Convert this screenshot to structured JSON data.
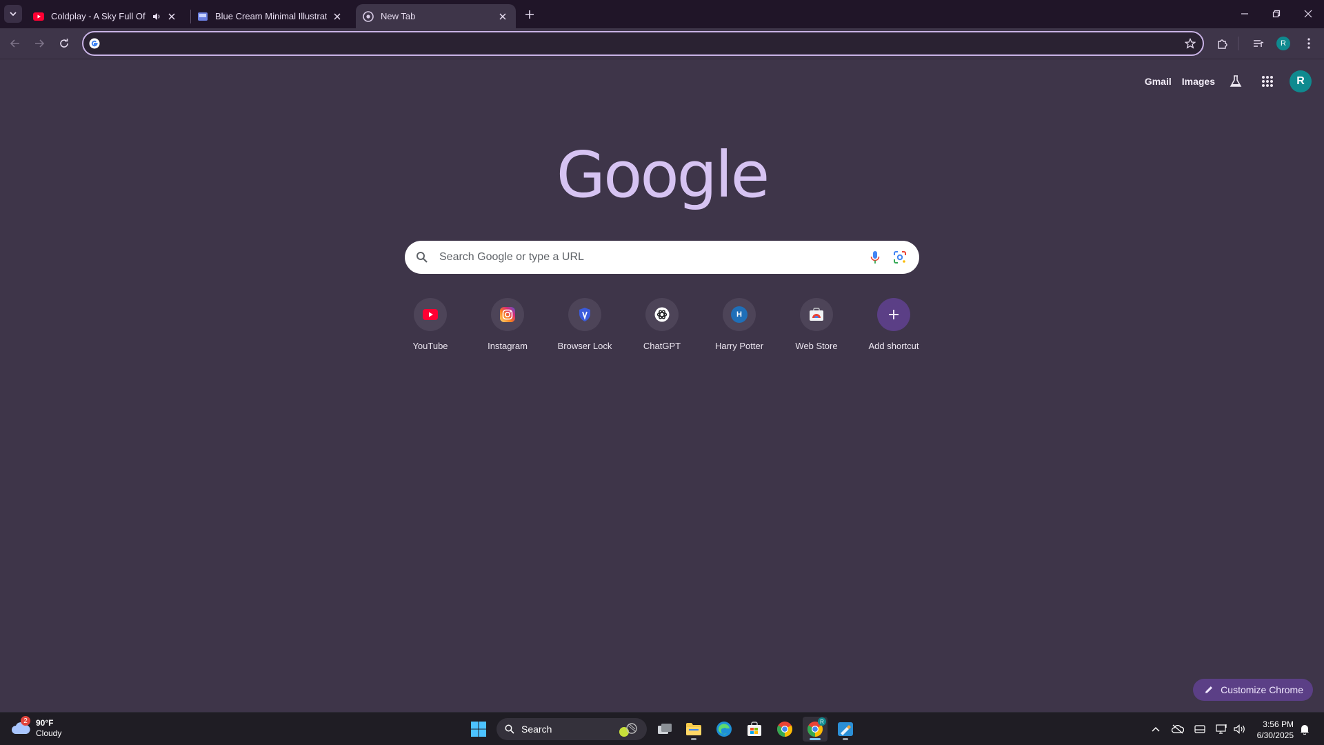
{
  "tabs": [
    {
      "title": "Coldplay - A Sky Full Of Stars",
      "favicon": "youtube-icon",
      "audio": true
    },
    {
      "title": "Blue Cream Minimal Illustrated",
      "favicon": "canva-icon",
      "audio": false
    },
    {
      "title": "New Tab",
      "favicon": "chrome-icon",
      "audio": false
    }
  ],
  "toolbar": {
    "omnibox_value": "",
    "profile_initial": "R"
  },
  "header": {
    "gmail": "Gmail",
    "images": "Images",
    "avatar_initial": "R"
  },
  "logo": "Google",
  "search": {
    "placeholder": "Search Google or type a URL"
  },
  "shortcuts": [
    {
      "label": "YouTube",
      "icon": "youtube-icon"
    },
    {
      "label": "Instagram",
      "icon": "instagram-icon"
    },
    {
      "label": "Browser Lock",
      "icon": "shield-icon"
    },
    {
      "label": "ChatGPT",
      "icon": "chatgpt-icon"
    },
    {
      "label": "Harry Potter",
      "icon": "letter-h-icon",
      "initial": "H"
    },
    {
      "label": "Web Store",
      "icon": "web-store-icon"
    },
    {
      "label": "Add shortcut",
      "icon": "plus-icon"
    }
  ],
  "customize": "Customize Chrome",
  "taskbar": {
    "weather_temp": "90°F",
    "weather_cond": "Cloudy",
    "weather_badge": "2",
    "search_label": "Search",
    "time": "3:56 PM",
    "date": "6/30/2025"
  },
  "colors": {
    "page_bg": "#3e3549",
    "logo": "#d6c3f2",
    "accent": "#5b3f86"
  }
}
